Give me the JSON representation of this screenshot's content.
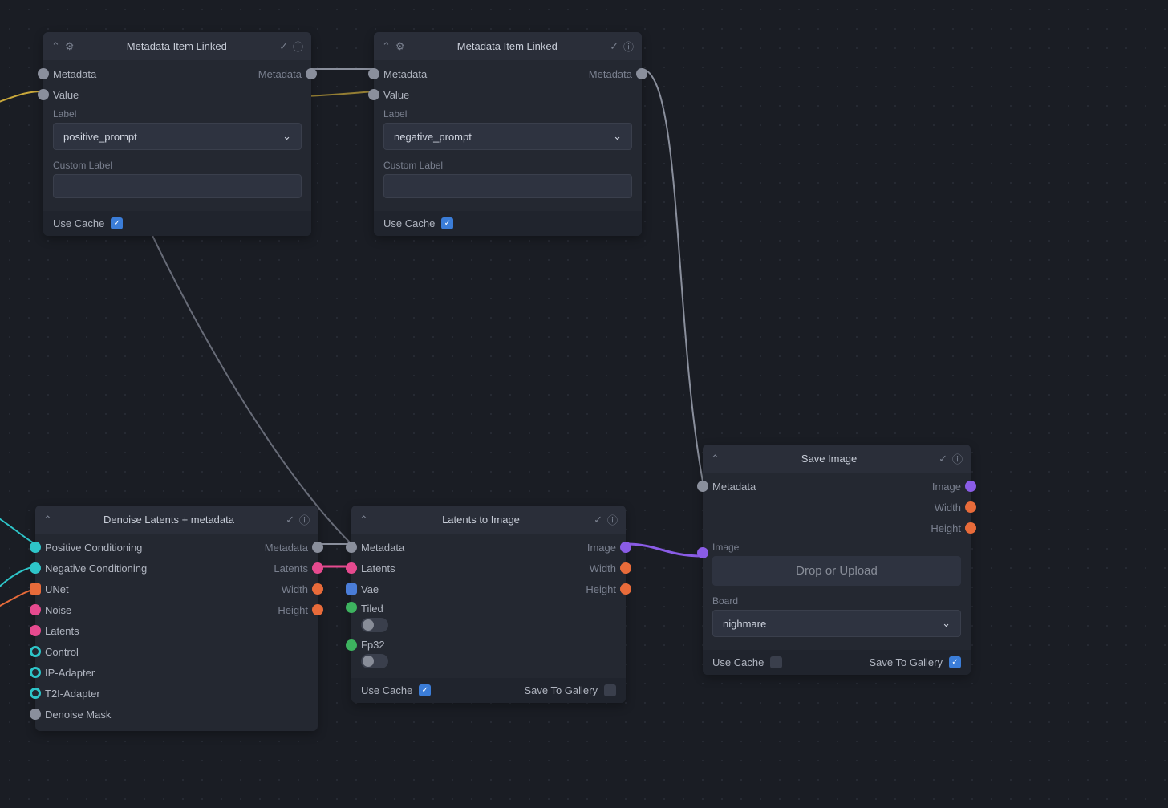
{
  "nodes": {
    "meta1": {
      "title": "Metadata Item Linked",
      "inputs": {
        "metadata": "Metadata",
        "value": "Value"
      },
      "outputs": {
        "metadata": "Metadata"
      },
      "label_field": "Label",
      "label_value": "positive_prompt",
      "custom_label_field": "Custom Label",
      "use_cache": "Use Cache"
    },
    "meta2": {
      "title": "Metadata Item Linked",
      "inputs": {
        "metadata": "Metadata",
        "value": "Value"
      },
      "outputs": {
        "metadata": "Metadata"
      },
      "label_field": "Label",
      "label_value": "negative_prompt",
      "custom_label_field": "Custom Label",
      "use_cache": "Use Cache"
    },
    "denoise": {
      "title": "Denoise Latents + metadata",
      "inputs": {
        "pos": "Positive Conditioning",
        "neg": "Negative Conditioning",
        "unet": "UNet",
        "noise": "Noise",
        "latents": "Latents",
        "control": "Control",
        "ip": "IP-Adapter",
        "t2i": "T2I-Adapter",
        "mask": "Denoise Mask"
      },
      "outputs": {
        "metadata": "Metadata",
        "latents": "Latents",
        "width": "Width",
        "height": "Height"
      }
    },
    "l2i": {
      "title": "Latents to Image",
      "inputs": {
        "metadata": "Metadata",
        "latents": "Latents",
        "vae": "Vae",
        "tiled": "Tiled",
        "fp32": "Fp32"
      },
      "outputs": {
        "image": "Image",
        "width": "Width",
        "height": "Height"
      },
      "use_cache": "Use Cache",
      "save_gallery": "Save To Gallery"
    },
    "save": {
      "title": "Save Image",
      "inputs": {
        "metadata": "Metadata"
      },
      "outputs": {
        "image": "Image",
        "width": "Width",
        "height": "Height"
      },
      "image_field": "Image",
      "dropzone": "Drop or Upload",
      "board_field": "Board",
      "board_value": "nighmare",
      "use_cache": "Use Cache",
      "save_gallery": "Save To Gallery"
    }
  },
  "colors": {
    "gray": "#8a8f9c",
    "cyan": "#2ec5c9",
    "orange": "#e86b3a",
    "pink": "#e64a8f",
    "blue": "#4a7dd8",
    "green": "#3db35f",
    "purple": "#8a5ce6"
  }
}
